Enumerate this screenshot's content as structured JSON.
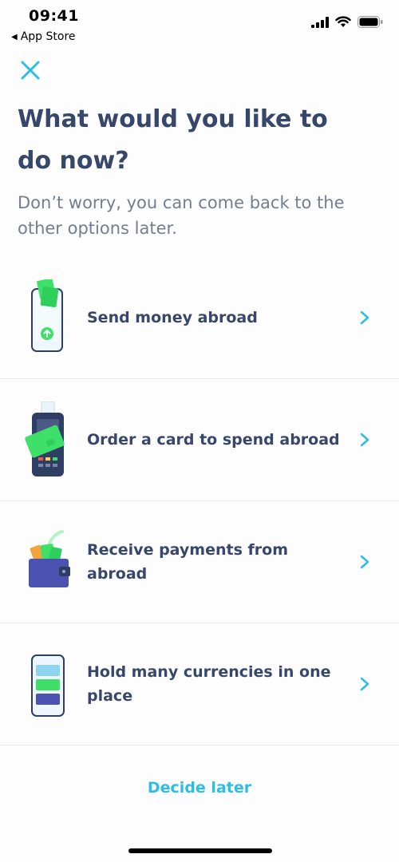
{
  "status_bar": {
    "time": "09:41",
    "back_label": "App Store",
    "icons": [
      "cellular-signal-icon",
      "wifi-icon",
      "battery-icon"
    ]
  },
  "header": {
    "close_icon": "close-icon",
    "title": "What would you like to do now?",
    "subtitle": "Don’t worry, you can come back to the other options later."
  },
  "options": [
    {
      "label": "Send money abroad",
      "icon": "phone-money-icon"
    },
    {
      "label": "Order a card to spend abroad",
      "icon": "card-terminal-icon"
    },
    {
      "label": "Receive payments from abroad",
      "icon": "wallet-money-icon"
    },
    {
      "label": "Hold many currencies in one place",
      "icon": "phone-currencies-icon"
    }
  ],
  "footer": {
    "decide_later": "Decide later"
  },
  "colors": {
    "accent": "#2ebde3",
    "title": "#37476b",
    "subtitle": "#747e8c",
    "green": "#3ee06a",
    "navy": "#2f3e63",
    "purple": "#4b52b0"
  }
}
